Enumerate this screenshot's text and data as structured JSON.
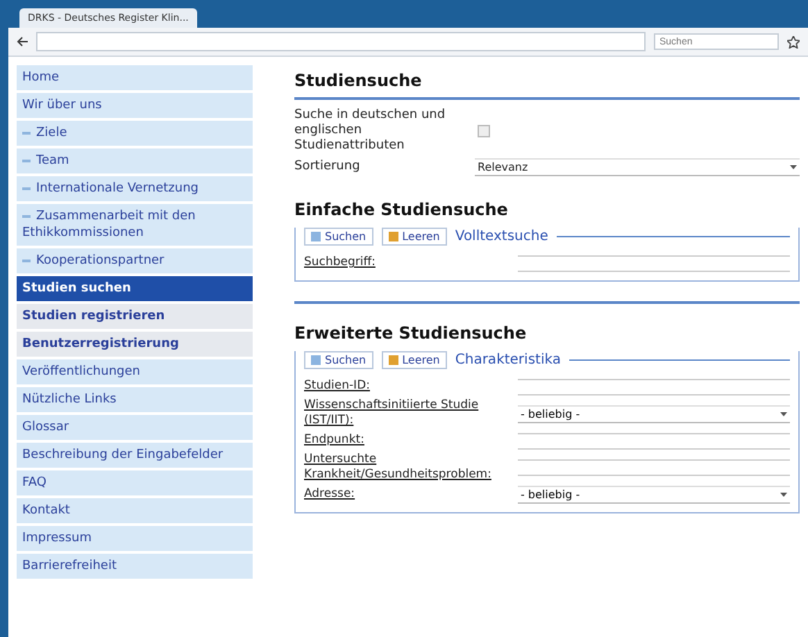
{
  "browser": {
    "tab_title": "DRKS - Deutsches Register Klin...",
    "search_placeholder": "Suchen"
  },
  "sidebar": {
    "items": [
      {
        "label": "Home",
        "kind": "link",
        "selected": false
      },
      {
        "label": "Wir über uns",
        "kind": "link",
        "selected": false
      },
      {
        "label": "Ziele",
        "kind": "sub",
        "selected": false
      },
      {
        "label": "Team",
        "kind": "sub",
        "selected": false
      },
      {
        "label": "Internationale Vernetzung",
        "kind": "sub",
        "selected": false
      },
      {
        "label": "Zusammenarbeit mit den Ethikkommissionen",
        "kind": "sub",
        "selected": false
      },
      {
        "label": "Kooperationspartner",
        "kind": "sub",
        "selected": false
      },
      {
        "label": "Studien suchen",
        "kind": "main",
        "selected": true
      },
      {
        "label": "Studien registrieren",
        "kind": "main",
        "selected": false
      },
      {
        "label": "Benutzerregistrierung",
        "kind": "main",
        "selected": false
      },
      {
        "label": "Veröffentlichungen",
        "kind": "link",
        "selected": false
      },
      {
        "label": "Nützliche Links",
        "kind": "link",
        "selected": false
      },
      {
        "label": "Glossar",
        "kind": "link",
        "selected": false
      },
      {
        "label": "Beschreibung der Eingabefelder",
        "kind": "link",
        "selected": false
      },
      {
        "label": "FAQ",
        "kind": "link",
        "selected": false
      },
      {
        "label": "Kontakt",
        "kind": "link",
        "selected": false
      },
      {
        "label": "Impressum",
        "kind": "link",
        "selected": false
      },
      {
        "label": "Barrierefreiheit",
        "kind": "link",
        "selected": false
      }
    ]
  },
  "search": {
    "title": "Studiensuche",
    "language_label": "Suche in deutschen und englischen Studienattributen",
    "language_checked": false,
    "sort_label": "Sortierung",
    "sort_value": "Relevanz"
  },
  "simple": {
    "title": "Einfache Studiensuche",
    "search_button": "Suchen",
    "clear_button": "Leeren",
    "legend": "Volltextsuche",
    "fields": [
      {
        "label": "Suchbegriff:",
        "kind": "text"
      }
    ]
  },
  "advanced": {
    "title": "Erweiterte Studiensuche",
    "search_button": "Suchen",
    "clear_button": "Leeren",
    "legend": "Charakteristika",
    "fields": [
      {
        "label": "Studien-ID:",
        "kind": "text"
      },
      {
        "label": "Wissenschaftsinitiierte Studie (IST/IIT):",
        "kind": "select",
        "value": "- beliebig -"
      },
      {
        "label": "Endpunkt:",
        "kind": "text"
      },
      {
        "label": "Untersuchte Krankheit/Gesundheitsproblem:",
        "kind": "text"
      },
      {
        "label": "Adresse:",
        "kind": "select",
        "value": "- beliebig -"
      }
    ]
  }
}
